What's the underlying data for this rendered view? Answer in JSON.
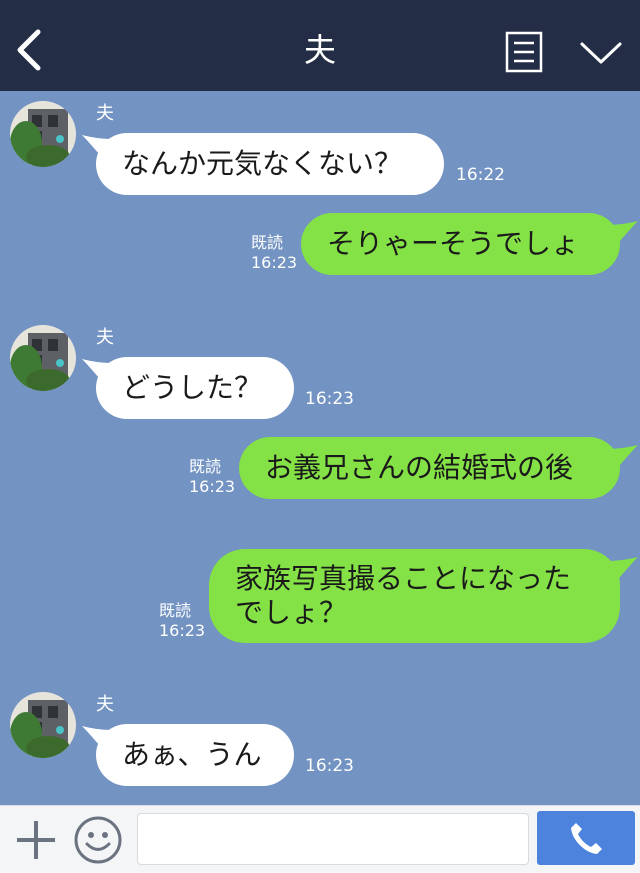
{
  "header": {
    "title": "夫",
    "back_icon": "chevron-left-icon",
    "notes_icon": "notes-icon",
    "menu_icon": "chevron-down-icon"
  },
  "messages": [
    {
      "direction": "in",
      "sender": "夫",
      "text": "なんか元気なくない？",
      "time": "16:22"
    },
    {
      "direction": "out",
      "read": "既読",
      "text": "そりゃーそうでしょ",
      "time": "16:23"
    },
    {
      "direction": "in",
      "sender": "夫",
      "text": "どうした？",
      "time": "16:23"
    },
    {
      "direction": "out",
      "read": "既読",
      "text": "お義兄さんの結婚式の後",
      "time": "16:23"
    },
    {
      "direction": "out",
      "read": "既読",
      "text_line1": "家族写真撮ることになった",
      "text_line2": "でしょ？",
      "time": "16:23"
    },
    {
      "direction": "in",
      "sender": "夫",
      "text": "あぁ、うん",
      "time": "16:23"
    }
  ],
  "input_bar": {
    "plus_icon": "plus-icon",
    "emoji_icon": "smiley-icon",
    "message_value": "",
    "call_icon": "phone-icon"
  },
  "colors": {
    "header_bg": "#232d45",
    "chat_bg": "#7393c3",
    "bubble_in": "#ffffff",
    "bubble_out": "#84e146",
    "call_button": "#4d83dc"
  }
}
